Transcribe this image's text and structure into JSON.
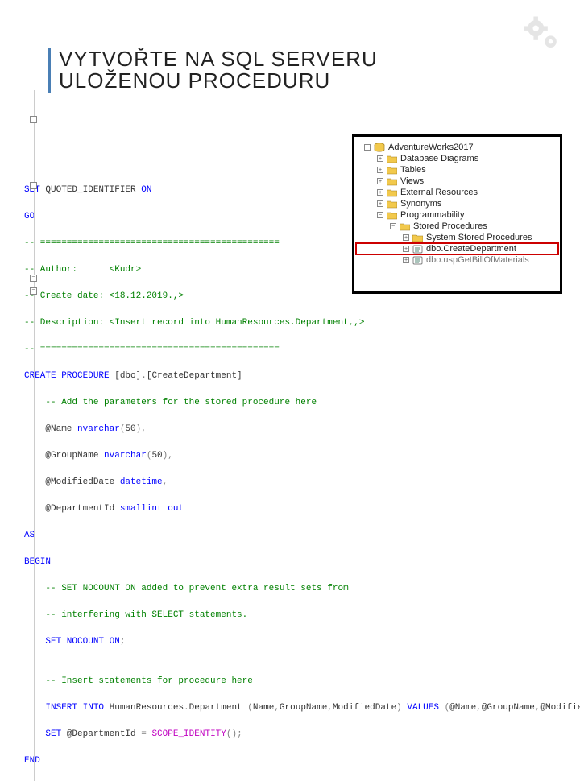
{
  "title": {
    "line1": "VYTVOŘTE NA SQL SERVERU",
    "line2": "ULOŽENOU PROCEDURU"
  },
  "code": {
    "l01a": "SET",
    "l01b": " QUOTED_IDENTIFIER ",
    "l01c": "ON",
    "l02": "GO",
    "l03": "-- =============================================",
    "l04": "-- Author:      <Kudr>",
    "l05": "-- Create date: <18.12.2019.,>",
    "l06": "-- Description: <Insert record into HumanResources.Department,,>",
    "l07": "-- =============================================",
    "l08a": "CREATE PROCEDURE",
    "l08b": " [dbo]",
    "l08c": ".",
    "l08d": "[CreateDepartment]",
    "l09": "    -- Add the parameters for the stored procedure here",
    "l10a": "    @Name ",
    "l10b": "nvarchar",
    "l10c": "(",
    "l10d": "50",
    "l10e": "),",
    "l11a": "    @GroupName ",
    "l11b": "nvarchar",
    "l11c": "(",
    "l11d": "50",
    "l11e": "),",
    "l12a": "    @ModifiedDate ",
    "l12b": "datetime",
    "l12c": ",",
    "l13a": "    @DepartmentId ",
    "l13b": "smallint ",
    "l13c": "out",
    "l14": "AS",
    "l15": "BEGIN",
    "l16": "    -- SET NOCOUNT ON added to prevent extra result sets from",
    "l17": "    -- interfering with SELECT statements.",
    "l18a": "    SET NOCOUNT ON",
    "l18b": ";",
    "l19": "",
    "l20": "    -- Insert statements for procedure here",
    "l21a": "    INSERT INTO",
    "l21b": " HumanResources",
    "l21c": ".",
    "l21d": "Department ",
    "l21e": "(",
    "l21f": "Name",
    "l21g": ",",
    "l21h": "GroupName",
    "l21i": ",",
    "l21j": "ModifiedDate",
    "l21k": ") ",
    "l21l": "VALUES ",
    "l21m": "(",
    "l21n": "@Name",
    "l21o": ",",
    "l21p": "@GroupName",
    "l21q": ",",
    "l21r": "@ModifiedDate",
    "l21s": ")",
    "l22a": "    SET",
    "l22b": " @DepartmentId ",
    "l22c": "= ",
    "l22d": "SCOPE_IDENTITY",
    "l22e": "();",
    "l23": "END"
  },
  "tree": {
    "n1": "AdventureWorks2017",
    "n2": "Database Diagrams",
    "n3": "Tables",
    "n4": "Views",
    "n5": "External Resources",
    "n6": "Synonyms",
    "n7": "Programmability",
    "n8": "Stored Procedures",
    "n9": "System Stored Procedures",
    "n10": "dbo.CreateDepartment",
    "n11": "dbo.uspGetBillOfMaterials"
  },
  "fold": {
    "minus": "−",
    "plus": "+"
  }
}
